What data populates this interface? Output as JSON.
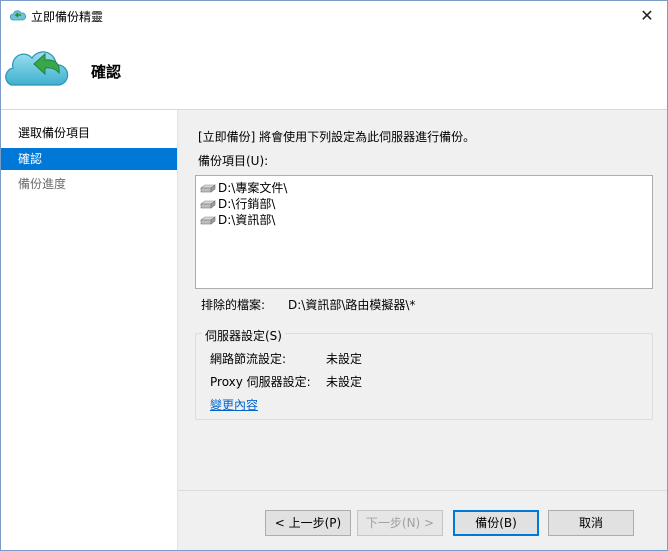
{
  "window": {
    "title": "立即備份精靈",
    "close_glyph": "✕"
  },
  "header": {
    "title": "確認",
    "icon": "cloud-backup-icon"
  },
  "sidebar": {
    "items": [
      {
        "label": "選取備份項目",
        "state": "normal"
      },
      {
        "label": "確認",
        "state": "active"
      },
      {
        "label": "備份進度",
        "state": "disabled"
      }
    ]
  },
  "main": {
    "description": "[立即備份] 將會使用下列設定為此伺服器進行備份。",
    "backup_items_label": "備份項目(U):",
    "backup_items": [
      "D:\\專案文件\\",
      "D:\\行銷部\\",
      "D:\\資訊部\\"
    ],
    "excluded_label": "排除的檔案:",
    "excluded_value": "D:\\資訊部\\路由模擬器\\*",
    "server_settings": {
      "title": "伺服器設定(S)",
      "throttle_label": "網路節流設定:",
      "throttle_value": "未設定",
      "proxy_label": "Proxy 伺服器設定:",
      "proxy_value": "未設定",
      "change_link": "變更內容"
    }
  },
  "buttons": {
    "back": "< 上一步(P)",
    "next": "下一步(N) >",
    "backup": "備份(B)",
    "cancel": "取消"
  },
  "colors": {
    "accent": "#0078d7",
    "link": "#0066cc",
    "content_bg": "#f0f0f0"
  }
}
